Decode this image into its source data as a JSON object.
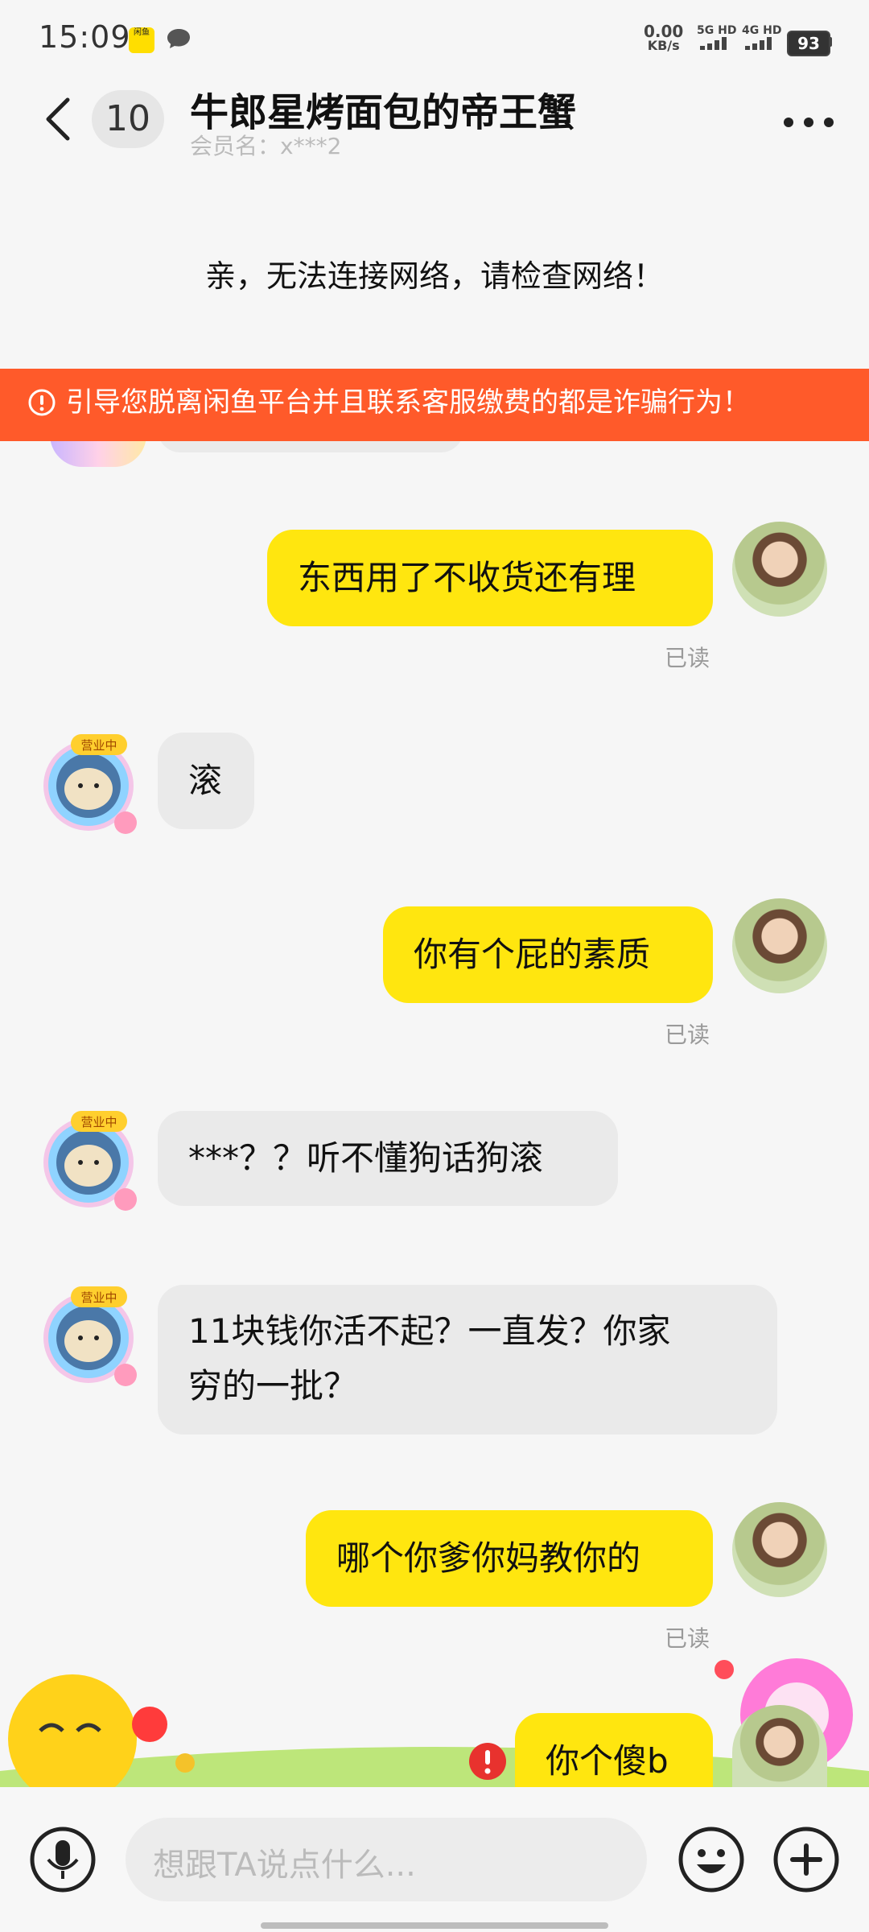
{
  "status_bar": {
    "time": "15:09",
    "app_badge": "闲鱼",
    "net_speed_value": "0.00",
    "net_speed_unit": "KB/s",
    "signal_1": "5G HD",
    "signal_2": "4G HD",
    "battery": "93"
  },
  "header": {
    "unread_count": "10",
    "title": "牛郎星烤面包的帝王蟹",
    "subtitle": "会员名：x***2"
  },
  "network_message": "亲，无法连接网络，请检查网络！",
  "warning_banner": "引导您脱离闲鱼平台并且联系客服缴费的都是诈骗行为！",
  "messages": [
    {
      "from": "self",
      "text": "东西用了不收货还有理",
      "status": "已读"
    },
    {
      "from": "other",
      "text": "滚"
    },
    {
      "from": "self",
      "text": "你有个屁的素质",
      "status": "已读"
    },
    {
      "from": "other",
      "text": "***？？听不懂狗话狗滚"
    },
    {
      "from": "other",
      "text_line1": "11块钱你活不起？一直发？你家",
      "text_line2": "穷的一批？"
    },
    {
      "from": "self",
      "text": "哪个你爹你妈教你的",
      "status": "已读"
    },
    {
      "from": "self",
      "text": "你个傻b",
      "status": "failed"
    }
  ],
  "other_avatar_badge": "营业中",
  "input": {
    "placeholder": "想跟TA说点什么..."
  },
  "colors": {
    "accent": "#ffe60f",
    "warning": "#ff5a2a",
    "bubble_other": "#eaeaea"
  }
}
